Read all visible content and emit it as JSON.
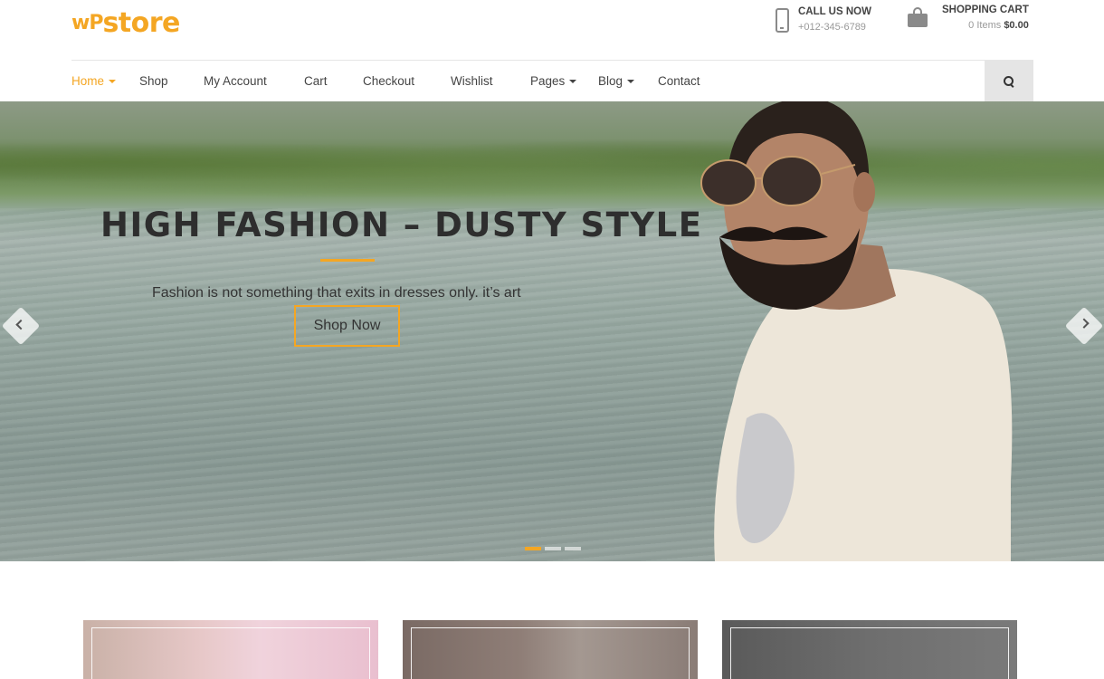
{
  "brand": {
    "logo_wp": "wP",
    "logo_store": "store",
    "accent_color": "#f4a623"
  },
  "header": {
    "contact": {
      "title": "CALL US NOW",
      "phone": "+012-345-6789",
      "icon": "phone-icon"
    },
    "cart": {
      "title": "SHOPPING CART",
      "items_text": "0 Items",
      "total": "$0.00",
      "icon": "shopping-bag-icon"
    }
  },
  "nav": {
    "items": [
      {
        "label": "Home",
        "has_dropdown": true,
        "active": true
      },
      {
        "label": "Shop",
        "has_dropdown": false
      },
      {
        "label": "My Account",
        "has_dropdown": false
      },
      {
        "label": "Cart",
        "has_dropdown": false
      },
      {
        "label": "Checkout",
        "has_dropdown": false
      },
      {
        "label": "Wishlist",
        "has_dropdown": false
      },
      {
        "label": "Pages",
        "has_dropdown": true
      },
      {
        "label": "Blog",
        "has_dropdown": true
      },
      {
        "label": "Contact",
        "has_dropdown": false
      }
    ],
    "search_icon": "search-icon"
  },
  "hero": {
    "title": "HIGH FASHION – DUSTY STYLE",
    "subtitle": "Fashion is not something that exits in  dresses only. it’s art",
    "button_label": "Shop Now",
    "slides_total": 3,
    "active_slide": 1
  }
}
